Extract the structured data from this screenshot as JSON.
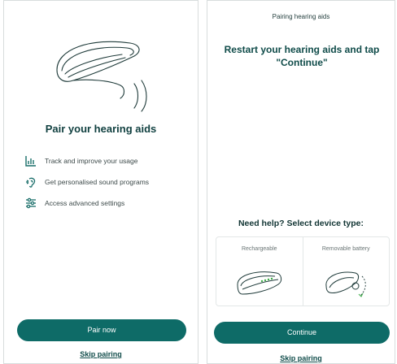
{
  "left": {
    "title": "Pair your hearing aids",
    "features": [
      {
        "icon": "chart-bars-icon",
        "label": "Track and improve your usage"
      },
      {
        "icon": "ear-sound-icon",
        "label": "Get personalised sound programs"
      },
      {
        "icon": "settings-sliders-icon",
        "label": "Access advanced settings"
      }
    ],
    "pair_button": "Pair now",
    "skip_link": "Skip pairing"
  },
  "right": {
    "header": "Pairing hearing aids",
    "instruction": "Restart your hearing aids and tap \"Continue\"",
    "help_title": "Need help? Select device type:",
    "device_types": [
      {
        "label": "Rechargeable",
        "icon": "rechargeable-hearing-aid-icon"
      },
      {
        "label": "Removable battery",
        "icon": "removable-battery-hearing-aid-icon"
      }
    ],
    "continue_button": "Continue",
    "skip_link": "Skip pairing"
  },
  "colors": {
    "accent": "#0e6b67",
    "title": "#0f4b49",
    "text": "#3d4a4a"
  }
}
